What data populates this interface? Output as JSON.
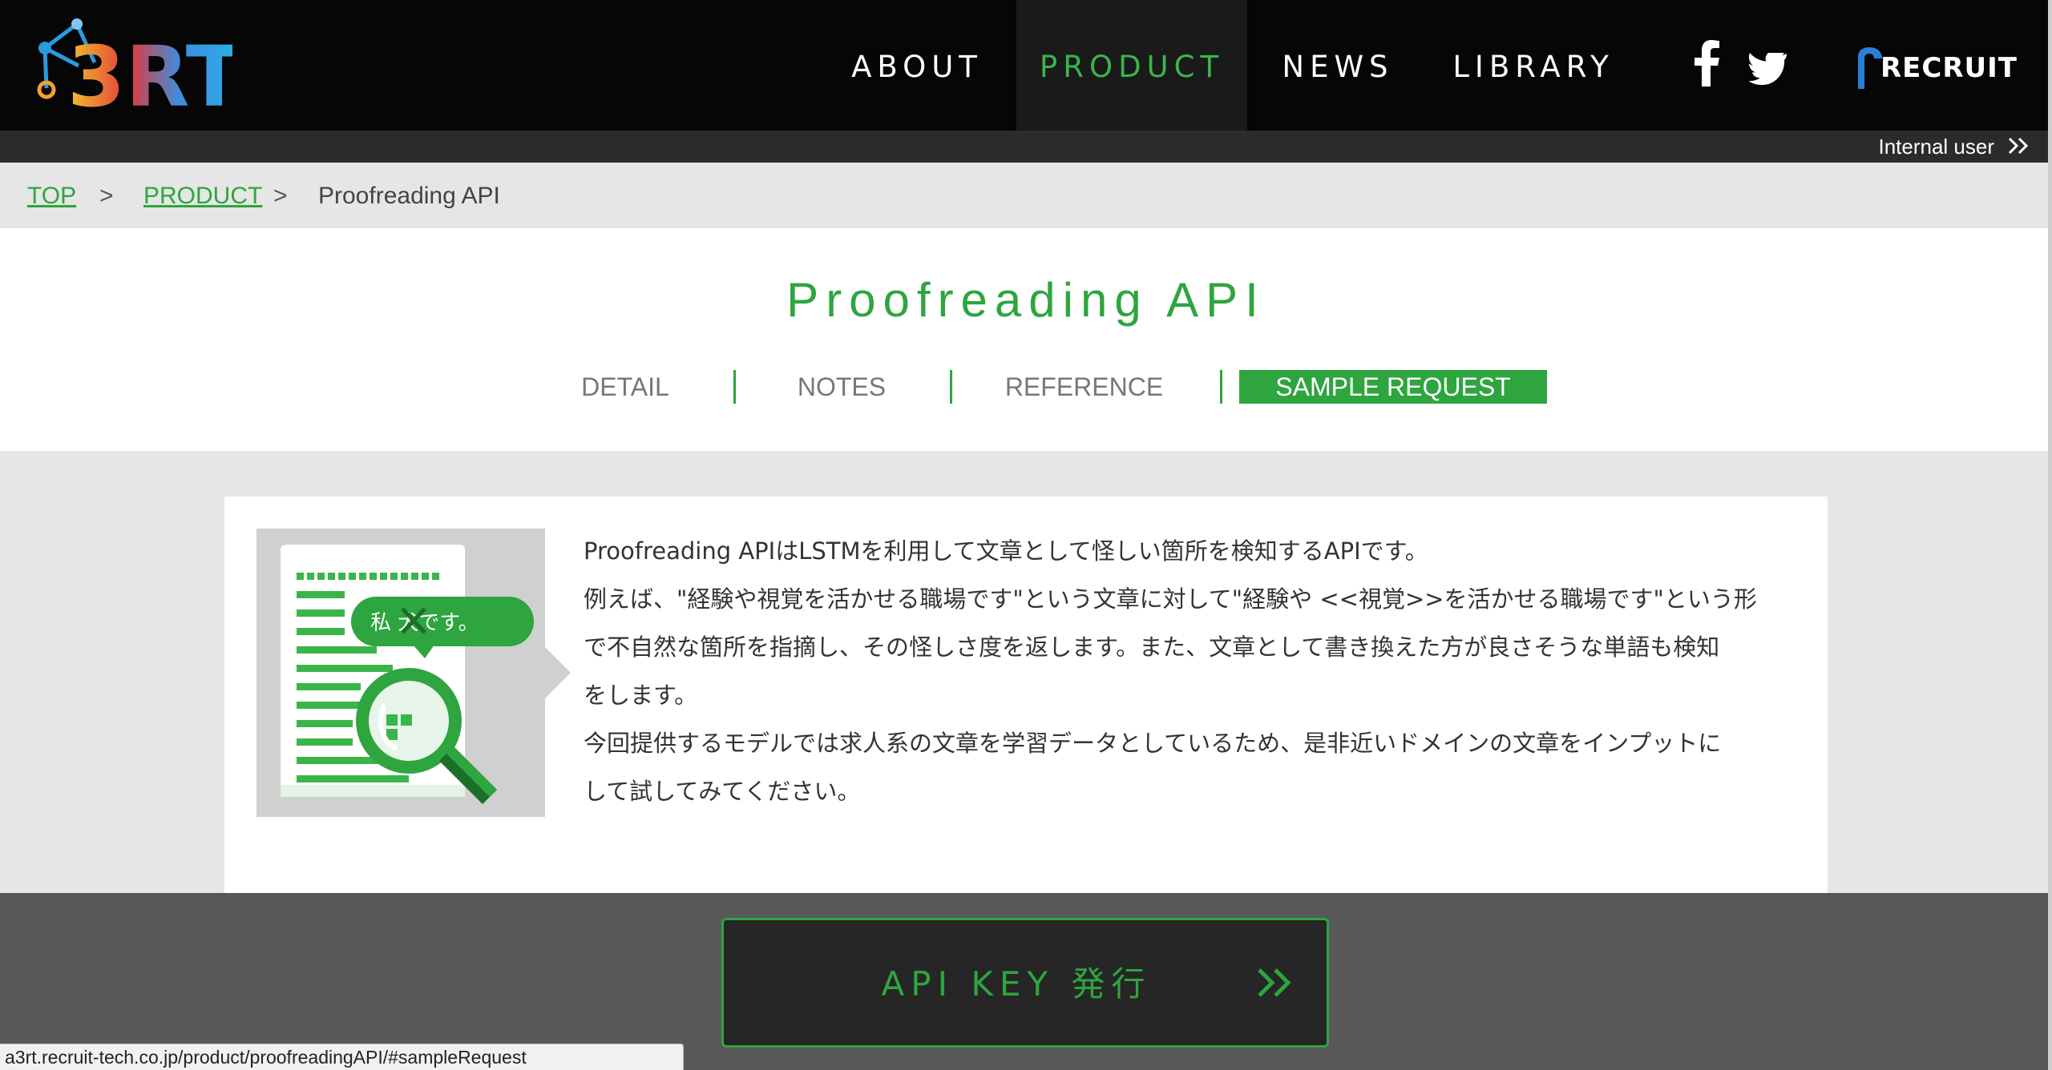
{
  "header": {
    "logo_text": "A3RT",
    "nav": [
      {
        "label": "ABOUT"
      },
      {
        "label": "PRODUCT"
      },
      {
        "label": "NEWS"
      },
      {
        "label": "LIBRARY"
      }
    ],
    "brand": "RECRUIT",
    "internal_user": "Internal user"
  },
  "breadcrumb": {
    "top": "TOP",
    "product": "PRODUCT",
    "separator": ">",
    "current": "Proofreading API"
  },
  "page": {
    "title": "Proofreading API",
    "tabs": [
      {
        "label": "DETAIL"
      },
      {
        "label": "NOTES"
      },
      {
        "label": "REFERENCE"
      },
      {
        "label": "SAMPLE REQUEST"
      }
    ]
  },
  "illustration": {
    "bubble_text": "私 犬です。"
  },
  "description": {
    "lines": [
      "Proofreading APIはLSTMを利用して文章として怪しい箇所を検知するAPIです。",
      "例えば、\"経験や視覚を活かせる職場です\"という文章に対して\"経験や <<視覚>>を活かせる職場です\"という形",
      "で不自然な箇所を指摘し、その怪しさ度を返します。また、文章として書き換えた方が良さそうな単語も検知",
      "をします。",
      "今回提供するモデルでは求人系の文章を学習データとしているため、是非近いドメインの文章をインプットに",
      "して試してみてください。"
    ]
  },
  "api_key_button": {
    "label": "API KEY 発行"
  },
  "status_bar": {
    "url": "a3rt.recruit-tech.co.jp/product/proofreadingAPI/#sampleRequest"
  },
  "colors": {
    "accent": "#2ea53e",
    "header_bg": "#060606",
    "band_bg": "#585858"
  }
}
